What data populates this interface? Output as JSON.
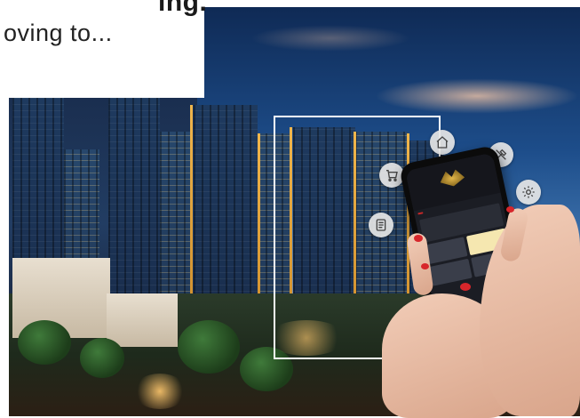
{
  "heading": {
    "line1": "ing.",
    "line2": "oving to..."
  },
  "icons": {
    "home": "home-icon",
    "tools": "tools-icon",
    "cart": "cart-icon",
    "settings": "gear-icon",
    "document": "document-icon"
  },
  "colors": {
    "accent": "#c62828",
    "frame": "#ffffff",
    "bubble": "#e6e6e6"
  }
}
